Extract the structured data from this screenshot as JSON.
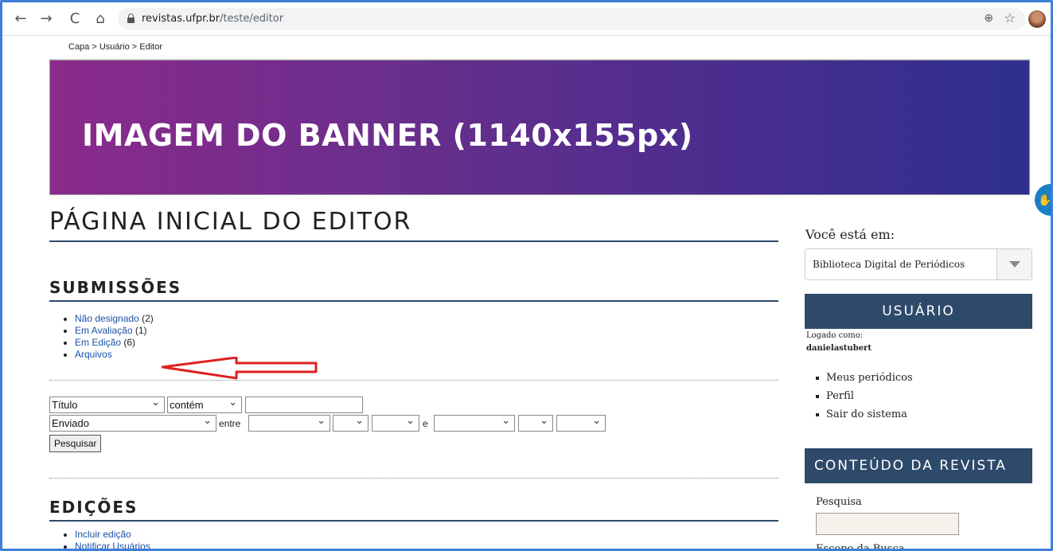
{
  "browser": {
    "url_host": "revistas.ufpr.br",
    "url_path": "/teste/editor",
    "back": "←",
    "forward": "→",
    "reload": "C",
    "home": "⌂",
    "zoom": "⊕",
    "star": "☆"
  },
  "breadcrumb": "Capa > Usuário > Editor",
  "banner": {
    "text": "IMAGEM DO BANNER (1140x155px)"
  },
  "main": {
    "title": "PÁGINA INICIAL DO EDITOR",
    "submissions": {
      "heading": "SUBMISSÕES",
      "items": [
        {
          "label": "Não designado",
          "count": "(2)"
        },
        {
          "label": "Em Avaliação",
          "count": "(1)"
        },
        {
          "label": "Em Edição",
          "count": "(6)"
        },
        {
          "label": "Arquivos",
          "count": ""
        }
      ]
    },
    "search": {
      "field_select": "Título",
      "match_select": "contém",
      "query_value": "",
      "date_select": "Enviado",
      "between_label": "entre",
      "and_label": "e",
      "button": "Pesquisar"
    },
    "editions": {
      "heading": "EDIÇÕES",
      "items": [
        {
          "label": "Incluir edição"
        },
        {
          "label": "Notificar Usuários"
        }
      ]
    }
  },
  "sidebar": {
    "location_label": "Você está em:",
    "journal_select": "Biblioteca Digital de Periódicos",
    "user_block": {
      "title": "USUÁRIO",
      "logged_as_label": "Logado como:",
      "username": "danielastubert",
      "links": [
        "Meus periódicos",
        "Perfil",
        "Sair do sistema"
      ]
    },
    "content_block": {
      "title": "CONTEÚDO DA REVISTA",
      "search_label": "Pesquisa",
      "scope_label": "Escopo da Busca"
    }
  },
  "colors": {
    "accent_navy": "#2e4a6b",
    "link": "#1a50a8",
    "annotation_arrow": "#e02020",
    "frame": "#3d7fd6"
  }
}
